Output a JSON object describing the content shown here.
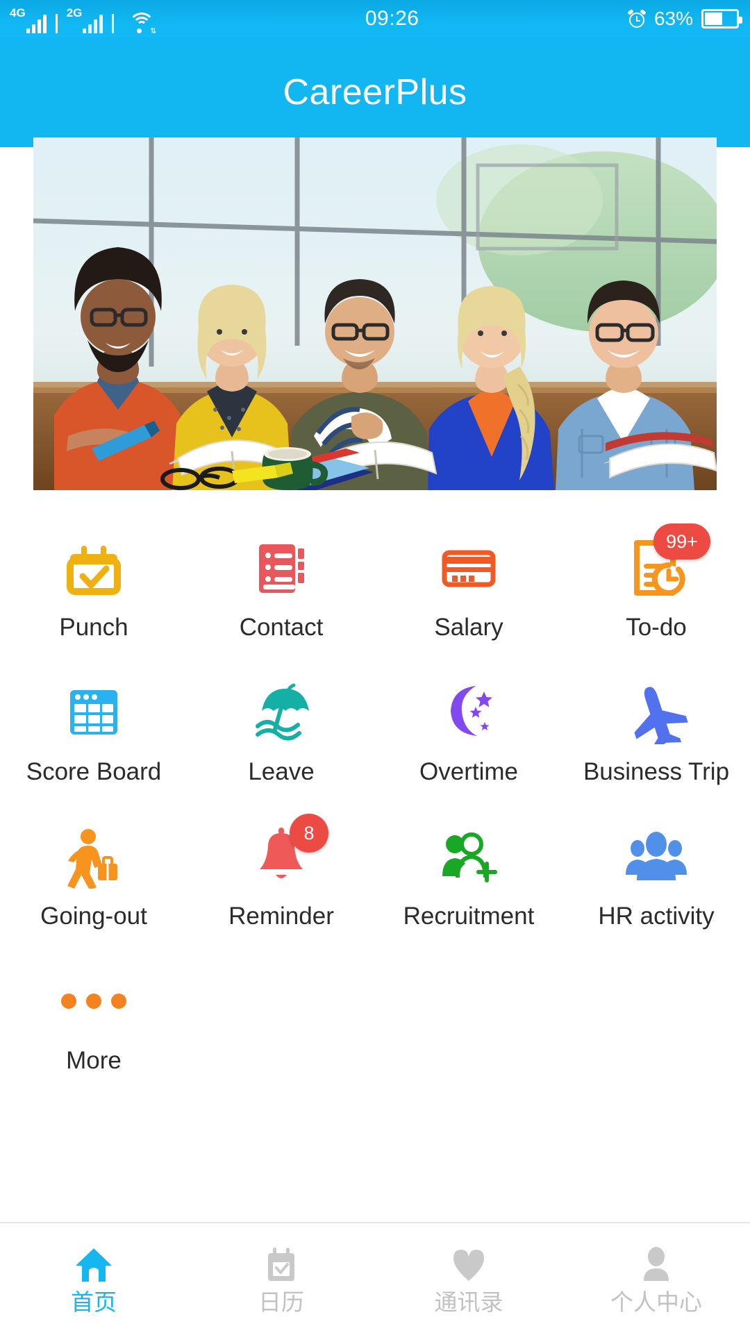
{
  "status_bar": {
    "sim1_network": "4G",
    "sim2_network": "2G",
    "wifi_icon": "wifi-icon",
    "time": "09:26",
    "alarm_icon": "alarm-clock-icon",
    "battery_percent": "63%",
    "battery_level": 63
  },
  "header": {
    "title": "CareerPlus",
    "background_color": "#12b7f2"
  },
  "banner": {
    "alt": "Five smiling colleagues seated at a table with open books, notebooks and a coffee mug in a bright office"
  },
  "grid": {
    "items": [
      {
        "label": "Punch",
        "icon": "calendar-check-icon",
        "color": "#eeb111",
        "badge": null
      },
      {
        "label": "Contact",
        "icon": "address-book-icon",
        "color": "#e8575b",
        "badge": null
      },
      {
        "label": "Salary",
        "icon": "credit-card-icon",
        "color": "#f05a24",
        "badge": null
      },
      {
        "label": "To-do",
        "icon": "document-clock-icon",
        "color": "#f7961e",
        "badge": "99+"
      },
      {
        "label": "Score Board",
        "icon": "table-grid-icon",
        "color": "#2ab2f0",
        "badge": null
      },
      {
        "label": "Leave",
        "icon": "beach-umbrella-icon",
        "color": "#14b0a5",
        "badge": null
      },
      {
        "label": "Overtime",
        "icon": "moon-stars-icon",
        "color": "#8249f0",
        "badge": null
      },
      {
        "label": "Business Trip",
        "icon": "airplane-icon",
        "color": "#5271ef",
        "badge": null
      },
      {
        "label": "Going-out",
        "icon": "walking-briefcase-icon",
        "color": "#f7941e",
        "badge": null
      },
      {
        "label": "Reminder",
        "icon": "bell-icon",
        "color": "#ef5a58",
        "badge": "8"
      },
      {
        "label": "Recruitment",
        "icon": "add-person-icon",
        "color": "#19a826",
        "badge": null
      },
      {
        "label": "HR activity",
        "icon": "people-group-icon",
        "color": "#5090e8",
        "badge": null
      },
      {
        "label": "More",
        "icon": "ellipsis-icon",
        "color": "#f58220",
        "badge": null
      }
    ]
  },
  "bottom_nav": {
    "active_color": "#16b6f0",
    "inactive_color": "#c2c2c2",
    "items": [
      {
        "label": "首页",
        "icon": "home-icon",
        "active": true
      },
      {
        "label": "日历",
        "icon": "calendar-icon",
        "active": false
      },
      {
        "label": "通讯录",
        "icon": "heart-icon",
        "active": false
      },
      {
        "label": "个人中心",
        "icon": "user-profile-icon",
        "active": false
      }
    ]
  }
}
